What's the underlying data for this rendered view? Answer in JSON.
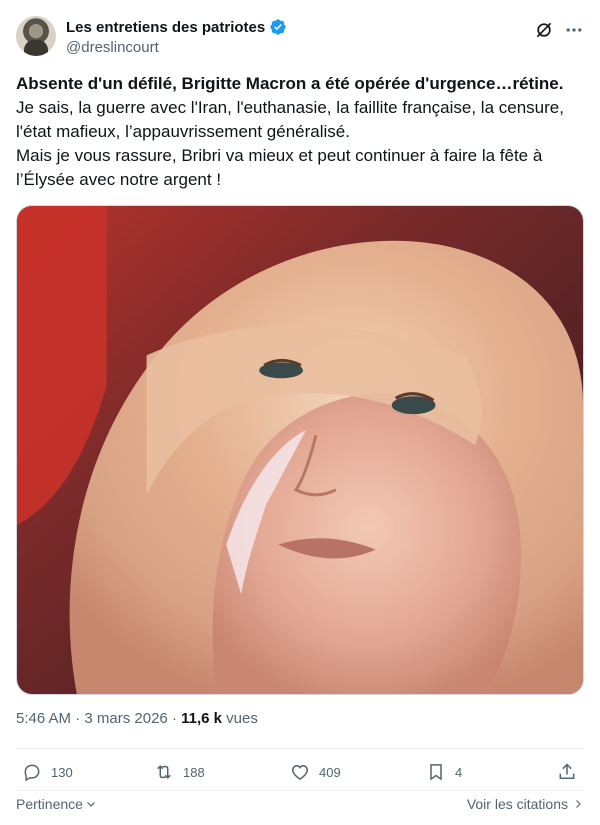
{
  "author": {
    "display_name": "Les entretiens des patriotes",
    "handle": "@dreslincourt"
  },
  "tweet": {
    "headline": "Absente d'un défilé, Brigitte Macron a été opérée d'urgence…rétine.",
    "paragraph_1": "Je sais, la guerre avec l'Iran, l'euthanasie, la faillite française, la censure, l'état mafieux, l’appauvrissement généralisé.",
    "paragraph_2": "Mais je vous rassure, Bribri va mieux et peut continuer à faire la fête à l’Élysée avec notre argent !"
  },
  "meta": {
    "time": "5:46 AM",
    "separator_1": " · ",
    "date": "3 mars 2026",
    "separator_2": " · ",
    "views_count": "11,6 k",
    "views_label": " vues"
  },
  "actions": {
    "replies": "130",
    "reposts": "188",
    "likes": "409",
    "bookmarks": "4"
  },
  "footer": {
    "sort_label": "Pertinence",
    "quotes_label": "Voir les citations"
  },
  "colors": {
    "accent": "#1d9bf0",
    "secondary_text": "#536471",
    "primary_text": "#0f1419"
  },
  "icons": {
    "verified": "verified-badge-icon",
    "grok": "grok-icon",
    "more": "more-icon",
    "reply": "reply-icon",
    "repost": "repost-icon",
    "like": "like-icon",
    "bookmark": "bookmark-icon",
    "share": "share-icon"
  }
}
